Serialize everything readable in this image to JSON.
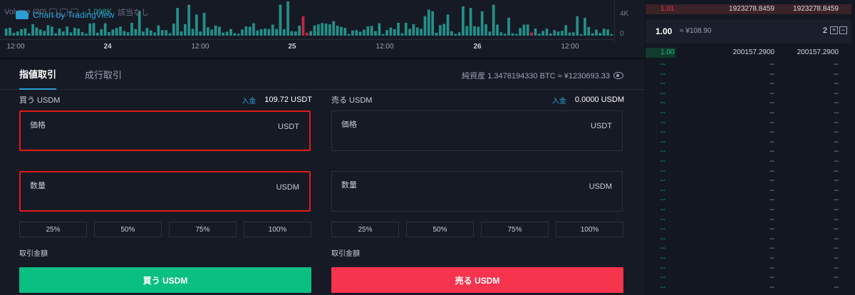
{
  "chart": {
    "legend_label": "Volume (20)",
    "legend_value": "1.098K",
    "legend_na": "該当なし",
    "brand": "Chart by TradingView",
    "y_ticks": [
      "4K",
      "0"
    ],
    "x_ticks": [
      {
        "label": "12:00",
        "bold": false
      },
      {
        "label": "24",
        "bold": true
      },
      {
        "label": "12:00",
        "bold": false
      },
      {
        "label": "25",
        "bold": true
      },
      {
        "label": "12:00",
        "bold": false
      },
      {
        "label": "26",
        "bold": true
      },
      {
        "label": "12:00",
        "bold": false
      }
    ],
    "up_color": "#26a69a",
    "down_color": "#e0294a"
  },
  "tabs": {
    "limit": "指値取引",
    "market": "成行取引",
    "assets": "純資産 1.3478194330 BTC ≈ ¥1230693.33"
  },
  "buy": {
    "title": "買う USDM",
    "deposit": "入金",
    "balance": "109.72 USDT",
    "price_label": "価格",
    "price_unit": "USDT",
    "qty_label": "数量",
    "qty_unit": "USDM",
    "percents": [
      "25%",
      "50%",
      "75%",
      "100%"
    ],
    "total_label": "取引金額",
    "action": "買う USDM"
  },
  "sell": {
    "title": "売る USDM",
    "deposit": "入金",
    "balance": "0.0000 USDM",
    "price_label": "価格",
    "price_unit": "USDT",
    "qty_label": "数量",
    "qty_unit": "USDM",
    "percents": [
      "25%",
      "50%",
      "75%",
      "100%"
    ],
    "total_label": "取引金額",
    "action": "売る USDM"
  },
  "book": {
    "ask": {
      "price": "1.01",
      "amount": "1923278.8459",
      "total": "1923278.8459"
    },
    "last_price": "1.00",
    "fiat": "≈ ¥108.90",
    "decimals": "2",
    "plus": "+",
    "minus": "−",
    "bid": {
      "price": "1.00",
      "amount": "200157.2900",
      "total": "200157.2900"
    },
    "empty_row": {
      "price": "--",
      "amount": "--",
      "total": "--"
    }
  }
}
